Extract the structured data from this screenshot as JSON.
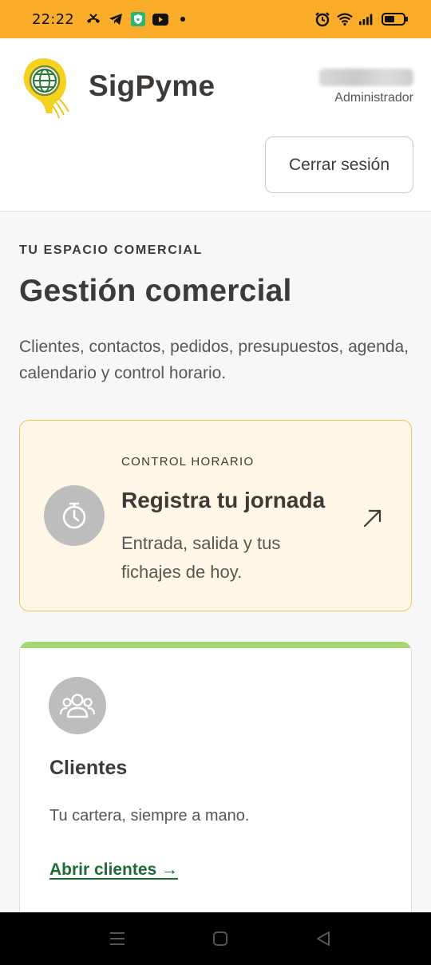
{
  "status_bar": {
    "time": "22:22",
    "left_icons": [
      "missed-call-icon",
      "telegram-icon",
      "vpn-shield-icon",
      "youtube-icon",
      "dot-icon"
    ],
    "right_icons": [
      "alarm-icon",
      "wifi-icon",
      "signal-icon",
      "battery-icon"
    ],
    "background": "#f9ad2a"
  },
  "header": {
    "brand": "SigPyme",
    "user_role": "Administrador",
    "logout_label": "Cerrar sesión"
  },
  "main": {
    "eyebrow": "TU ESPACIO COMERCIAL",
    "title": "Gestión comercial",
    "description": "Clientes, contactos, pedidos, presupuestos, agenda, calendario y control horario."
  },
  "time_card": {
    "eyebrow": "CONTROL HORARIO",
    "title": "Registra tu jornada",
    "description": "Entrada, salida y tus fichajes de hoy.",
    "icon": "stopwatch-icon",
    "background": "#fef6e6",
    "border": "#f0c35a"
  },
  "client_card": {
    "title": "Clientes",
    "description": "Tu cartera, siempre a mano.",
    "link": "Abrir clientes →",
    "icon": "users-icon",
    "accent": "#a6d672",
    "link_color": "#1e6b33"
  },
  "nav_bar": {
    "buttons": [
      "menu-icon",
      "home-icon",
      "back-icon"
    ]
  }
}
